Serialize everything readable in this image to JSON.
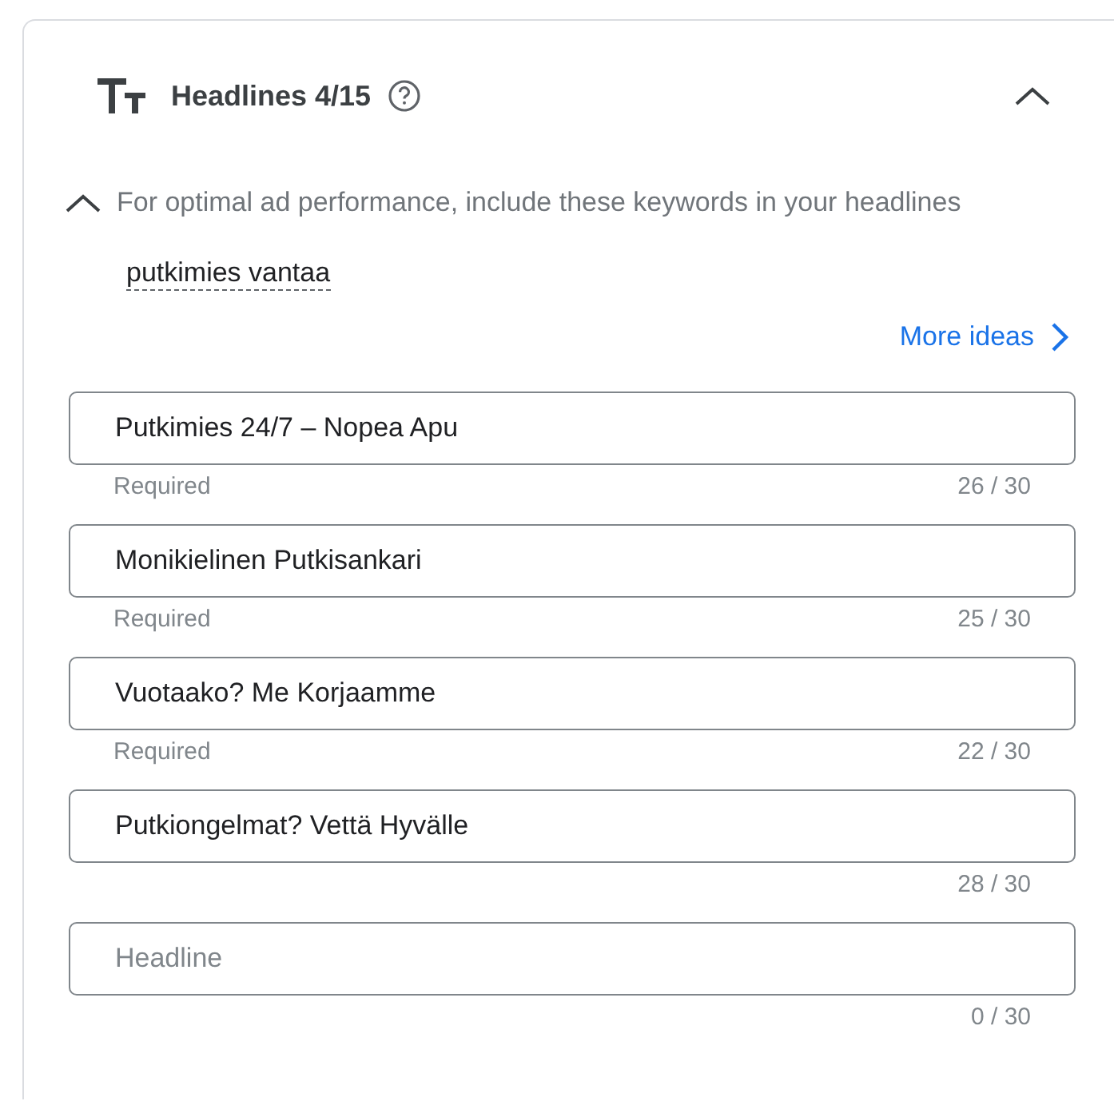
{
  "section": {
    "title": "Headlines 4/15",
    "expanded": true
  },
  "keywords": {
    "expanded": true,
    "note": "For optimal ad performance, include these keywords in your headlines",
    "items": [
      "putkimies vantaa"
    ],
    "more_link": "More ideas"
  },
  "headlines": [
    {
      "value": "Putkimies 24/7 – Nopea Apu",
      "helper": "Required",
      "counter": "26 / 30"
    },
    {
      "value": "Monikielinen Putkisankari",
      "helper": "Required",
      "counter": "25 / 30"
    },
    {
      "value": "Vuotaako? Me Korjaamme",
      "helper": "Required",
      "counter": "22 / 30"
    },
    {
      "value": "Putkiongelmat? Vettä Hyvälle",
      "counter": "28 / 30"
    },
    {
      "placeholder": "Headline",
      "counter": "0 / 30"
    }
  ]
}
